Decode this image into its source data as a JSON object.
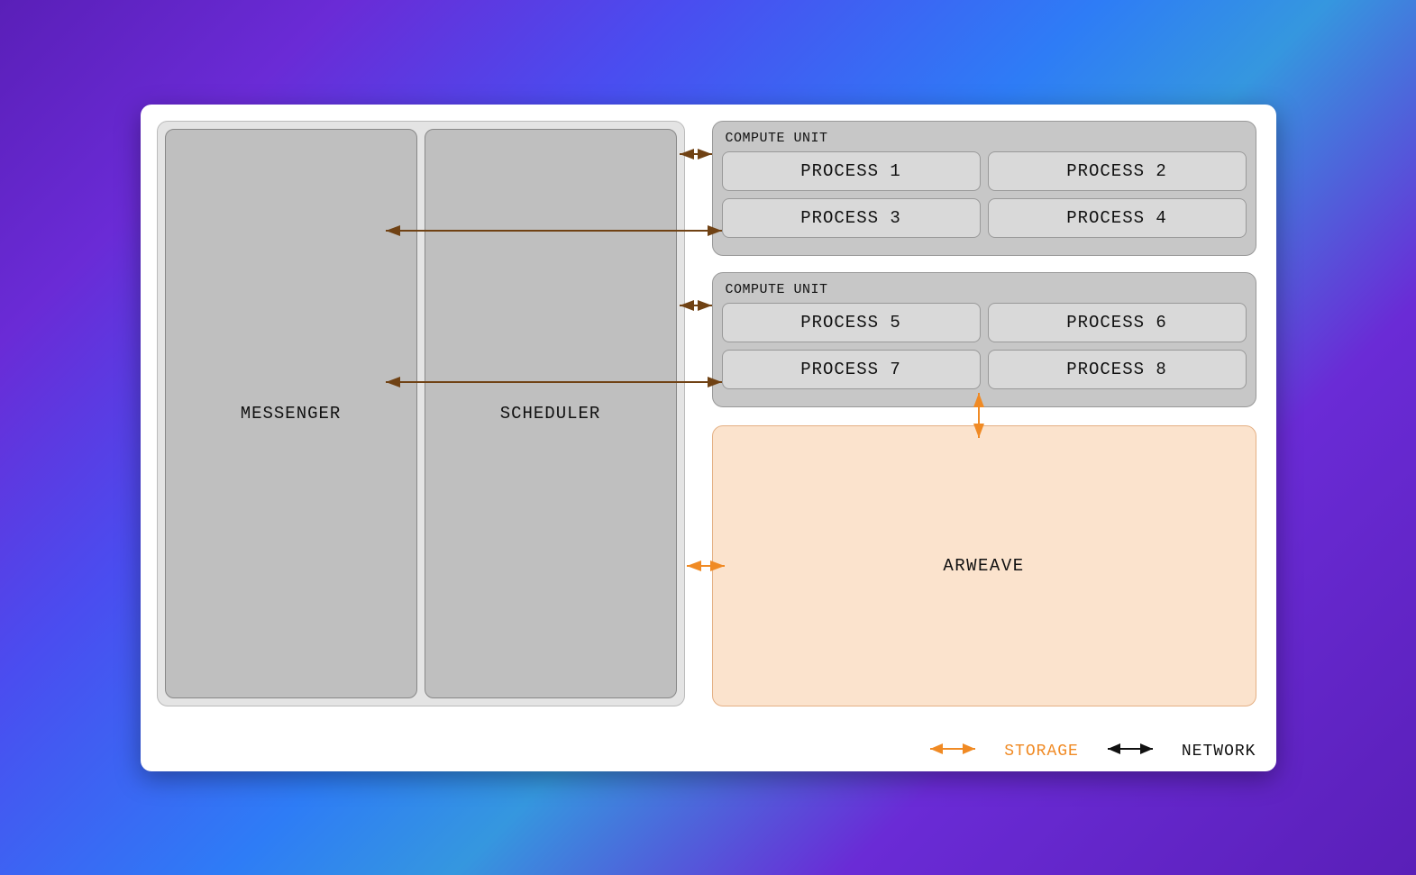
{
  "left": {
    "messenger": "MESSENGER",
    "scheduler": "SCHEDULER"
  },
  "compute_units": [
    {
      "title": "COMPUTE UNIT",
      "processes": [
        "PROCESS 1",
        "PROCESS 2",
        "PROCESS 3",
        "PROCESS 4"
      ]
    },
    {
      "title": "COMPUTE UNIT",
      "processes": [
        "PROCESS 5",
        "PROCESS 6",
        "PROCESS 7",
        "PROCESS 8"
      ]
    }
  ],
  "arweave": "ARWEAVE",
  "legend": {
    "storage": "STORAGE",
    "network": "NETWORK"
  },
  "colors": {
    "storage": "#f08a24",
    "network": "#704214"
  }
}
